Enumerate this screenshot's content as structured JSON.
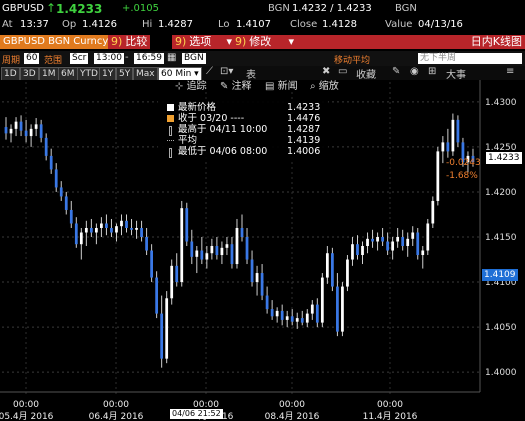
{
  "quote": {
    "symbol": "GBPUSD",
    "last": "1.4233",
    "change": "+.0105",
    "hi_label": "Hi",
    "hi": "1.4287",
    "lo_label": "Lo",
    "lo": "1.4107",
    "bid_ask": "1.4232 / 1.4233",
    "source": "BGN",
    "at_label": "At",
    "time": "13:37",
    "op_label": "Op",
    "open": "1.4126",
    "close_label": "Close",
    "close": "1.4128",
    "value_label": "Value",
    "value_date": "04/13/16",
    "source2": "BGN"
  },
  "tabs": {
    "ticker": "GBPUSD BGN Curncy",
    "compare_num": "9)",
    "compare": "比较",
    "options_num": "9)",
    "options": "选项",
    "edit_num": "9)",
    "edit": "修改",
    "chart_name": "日内K线图"
  },
  "settings": {
    "period_label": "周期",
    "period_value": "60",
    "range_label": "范围",
    "scr": "Scr",
    "start": "13:00",
    "dash": "-",
    "end": "16:59",
    "source": "BGN",
    "ma_label": "移动平均",
    "ma_value": "无下半周"
  },
  "toolbar": {
    "periods": [
      "1D",
      "3D",
      "1M",
      "6M",
      "YTD",
      "1Y",
      "5Y",
      "Max"
    ],
    "interval": "60 Min",
    "table_label": "表",
    "fav_label": "收藏",
    "zoom_label": "大事"
  },
  "chart_tools": {
    "track": "追踪",
    "annotate": "注释",
    "news": "新闻",
    "zoom": "缩放"
  },
  "legend": [
    {
      "name": "最新价格",
      "value": "1.4233",
      "color": "#ffffff"
    },
    {
      "name": "收于 03/20 ----",
      "value": "1.4476",
      "color": "#f0a030"
    },
    {
      "name": "最高于 04/11 10:00",
      "value": "1.4287",
      "color": "#ffffff"
    },
    {
      "name": "平均",
      "value": "1.4139",
      "color": "#ffffff"
    },
    {
      "name": "最低于 04/06 08:00",
      "value": "1.4006",
      "color": "#ffffff"
    }
  ],
  "price_tags": {
    "last": "1.4233",
    "change": "-0.0243",
    "change_pct": "-1.68%",
    "avg": "1.4109"
  },
  "colors": {
    "up": "#ffffff",
    "down": "#3a78e6",
    "accent": "#e07a1e",
    "tab": "#b8252a"
  },
  "chart_data": {
    "type": "candlestick",
    "y_ticks": [
      "1.4300",
      "1.4250",
      "1.4200",
      "1.4150",
      "1.4100",
      "1.4050",
      "1.4000"
    ],
    "ylim": [
      1.3978,
      1.4322
    ],
    "x_labels": [
      {
        "time": "00:00",
        "date": "05.4月 2016"
      },
      {
        "time": "00:00",
        "date": "06.4月 2016"
      },
      {
        "time": "00:00",
        "date": "07.4月 2016"
      },
      {
        "time": "00:00",
        "date": "08.4月 2016"
      },
      {
        "time": "00:00",
        "date": "11.4月 2016"
      }
    ],
    "hover_label": "04/06 21:52",
    "ohlc": [
      [
        1.4272,
        1.4283,
        1.4258,
        1.4265
      ],
      [
        1.4265,
        1.4275,
        1.4255,
        1.427
      ],
      [
        1.427,
        1.4283,
        1.4262,
        1.4278
      ],
      [
        1.4278,
        1.4285,
        1.4262,
        1.4268
      ],
      [
        1.4268,
        1.428,
        1.4255,
        1.4262
      ],
      [
        1.4262,
        1.4275,
        1.425,
        1.427
      ],
      [
        1.427,
        1.4282,
        1.4262,
        1.4275
      ],
      [
        1.4275,
        1.428,
        1.4255,
        1.426
      ],
      [
        1.426,
        1.4265,
        1.4235,
        1.424
      ],
      [
        1.424,
        1.4248,
        1.422,
        1.4225
      ],
      [
        1.4225,
        1.4232,
        1.42,
        1.4205
      ],
      [
        1.4205,
        1.4212,
        1.419,
        1.4195
      ],
      [
        1.4195,
        1.42,
        1.4175,
        1.418
      ],
      [
        1.418,
        1.419,
        1.416,
        1.4165
      ],
      [
        1.4165,
        1.4172,
        1.4138,
        1.4142
      ],
      [
        1.4142,
        1.416,
        1.4125,
        1.4155
      ],
      [
        1.4155,
        1.4168,
        1.414,
        1.416
      ],
      [
        1.416,
        1.417,
        1.415,
        1.4155
      ],
      [
        1.4155,
        1.4165,
        1.4142,
        1.416
      ],
      [
        1.416,
        1.4172,
        1.415,
        1.4165
      ],
      [
        1.4165,
        1.4175,
        1.4152,
        1.416
      ],
      [
        1.416,
        1.417,
        1.415,
        1.4155
      ],
      [
        1.4155,
        1.4165,
        1.4145,
        1.4162
      ],
      [
        1.4162,
        1.4175,
        1.4152,
        1.4168
      ],
      [
        1.4168,
        1.4175,
        1.4155,
        1.416
      ],
      [
        1.416,
        1.417,
        1.4152,
        1.4158
      ],
      [
        1.4158,
        1.4168,
        1.4148,
        1.416
      ],
      [
        1.416,
        1.4168,
        1.4145,
        1.415
      ],
      [
        1.415,
        1.416,
        1.413,
        1.4135
      ],
      [
        1.4135,
        1.4142,
        1.41,
        1.4105
      ],
      [
        1.4105,
        1.4112,
        1.406,
        1.4065
      ],
      [
        1.4065,
        1.4085,
        1.4005,
        1.4015
      ],
      [
        1.4015,
        1.409,
        1.401,
        1.4082
      ],
      [
        1.4082,
        1.4125,
        1.4075,
        1.4118
      ],
      [
        1.4118,
        1.4132,
        1.4095,
        1.41
      ],
      [
        1.41,
        1.419,
        1.4095,
        1.4182
      ],
      [
        1.4182,
        1.4188,
        1.414,
        1.4145
      ],
      [
        1.4145,
        1.4158,
        1.412,
        1.4128
      ],
      [
        1.4128,
        1.414,
        1.411,
        1.4135
      ],
      [
        1.4135,
        1.415,
        1.412,
        1.4125
      ],
      [
        1.4125,
        1.414,
        1.4115,
        1.4132
      ],
      [
        1.4132,
        1.4148,
        1.4125,
        1.414
      ],
      [
        1.414,
        1.415,
        1.4125,
        1.413
      ],
      [
        1.413,
        1.4145,
        1.412,
        1.4138
      ],
      [
        1.4138,
        1.415,
        1.413,
        1.4142
      ],
      [
        1.4142,
        1.415,
        1.4115,
        1.412
      ],
      [
        1.412,
        1.417,
        1.4115,
        1.416
      ],
      [
        1.416,
        1.4175,
        1.4145,
        1.415
      ],
      [
        1.415,
        1.416,
        1.412,
        1.4125
      ],
      [
        1.4125,
        1.4135,
        1.4095,
        1.41
      ],
      [
        1.41,
        1.4118,
        1.4085,
        1.411
      ],
      [
        1.411,
        1.412,
        1.408,
        1.4085
      ],
      [
        1.4085,
        1.4095,
        1.4065,
        1.407
      ],
      [
        1.407,
        1.408,
        1.4058,
        1.4062
      ],
      [
        1.4062,
        1.4072,
        1.4055,
        1.4068
      ],
      [
        1.4068,
        1.4075,
        1.4052,
        1.4058
      ],
      [
        1.4058,
        1.4068,
        1.405,
        1.4062
      ],
      [
        1.4062,
        1.407,
        1.4052,
        1.4056
      ],
      [
        1.4056,
        1.4066,
        1.4048,
        1.406
      ],
      [
        1.406,
        1.4068,
        1.4052,
        1.4055
      ],
      [
        1.4055,
        1.407,
        1.405,
        1.4065
      ],
      [
        1.4065,
        1.408,
        1.4058,
        1.4075
      ],
      [
        1.4075,
        1.4082,
        1.405,
        1.4055
      ],
      [
        1.4055,
        1.411,
        1.405,
        1.4105
      ],
      [
        1.4105,
        1.414,
        1.4098,
        1.4132
      ],
      [
        1.4132,
        1.4138,
        1.409,
        1.4095
      ],
      [
        1.4095,
        1.411,
        1.404,
        1.4045
      ],
      [
        1.4045,
        1.41,
        1.404,
        1.4095
      ],
      [
        1.4095,
        1.413,
        1.409,
        1.4125
      ],
      [
        1.4125,
        1.415,
        1.4118,
        1.4142
      ],
      [
        1.4142,
        1.4152,
        1.4125,
        1.413
      ],
      [
        1.413,
        1.4145,
        1.412,
        1.414
      ],
      [
        1.414,
        1.4155,
        1.4132,
        1.4148
      ],
      [
        1.4148,
        1.4158,
        1.4138,
        1.4145
      ],
      [
        1.4145,
        1.4155,
        1.4135,
        1.415
      ],
      [
        1.415,
        1.416,
        1.414,
        1.4145
      ],
      [
        1.4145,
        1.4155,
        1.413,
        1.4135
      ],
      [
        1.4135,
        1.415,
        1.4125,
        1.4145
      ],
      [
        1.4145,
        1.416,
        1.4138,
        1.415
      ],
      [
        1.415,
        1.4158,
        1.4135,
        1.414
      ],
      [
        1.414,
        1.4155,
        1.4128,
        1.4148
      ],
      [
        1.4148,
        1.4162,
        1.414,
        1.4155
      ],
      [
        1.4155,
        1.416,
        1.4125,
        1.413
      ],
      [
        1.413,
        1.414,
        1.4115,
        1.4135
      ],
      [
        1.4135,
        1.417,
        1.413,
        1.4165
      ],
      [
        1.4165,
        1.4195,
        1.416,
        1.419
      ],
      [
        1.419,
        1.425,
        1.4185,
        1.4245
      ],
      [
        1.4245,
        1.4262,
        1.4232,
        1.4255
      ],
      [
        1.4255,
        1.427,
        1.4238,
        1.4245
      ],
      [
        1.4245,
        1.4287,
        1.424,
        1.428
      ],
      [
        1.428,
        1.4285,
        1.425,
        1.4255
      ],
      [
        1.4255,
        1.426,
        1.4228,
        1.4233
      ],
      [
        1.4233,
        1.4245,
        1.4222,
        1.424
      ],
      [
        1.424,
        1.4248,
        1.4228,
        1.4233
      ]
    ]
  }
}
